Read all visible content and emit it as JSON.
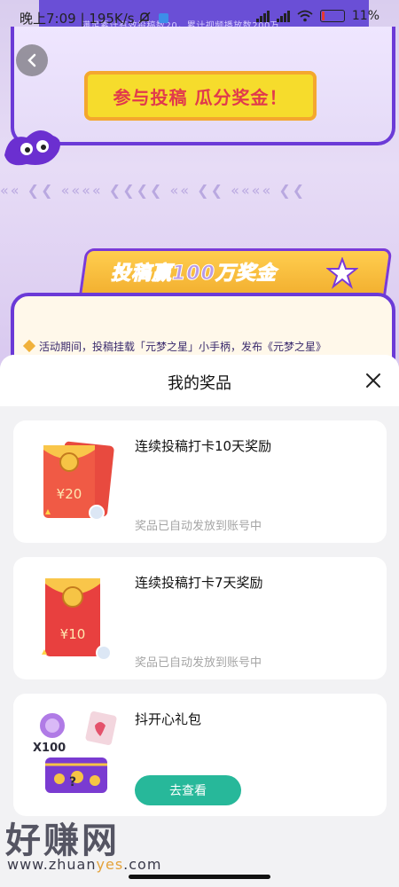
{
  "status_bar": {
    "time_speed": "晚上7:09 | 195K/s",
    "battery": "11%"
  },
  "background": {
    "top_info": "满足累计有效投稿数20，累计视频播放数200万",
    "cta_banner": "参与投稿 瓜分奖金！",
    "section_banner": "投稿赢100万奖金",
    "info_text": "活动期间，投稿挂载「元梦之星」小手柄，发布《元梦之星》"
  },
  "sheet": {
    "title": "我的奖品",
    "close_icon": "close-icon"
  },
  "prizes": [
    {
      "title": "连续投稿打卡10天奖励",
      "amount": "¥20",
      "status": "奖品已自动发放到账号中"
    },
    {
      "title": "连续投稿打卡7天奖励",
      "amount": "¥10",
      "status": "奖品已自动发放到账号中"
    },
    {
      "title": "抖开心礼包",
      "count": "X100",
      "button_label": "去查看"
    }
  ],
  "watermark": {
    "brand": "好赚网",
    "url_prefix": "www.zhuan",
    "url_accent": "yes",
    "url_suffix": ".com"
  },
  "colors": {
    "accent": "#27b89a",
    "background_purple": "#6b3ad7",
    "red_packet": "#e8403f",
    "gold": "#f6c445"
  }
}
